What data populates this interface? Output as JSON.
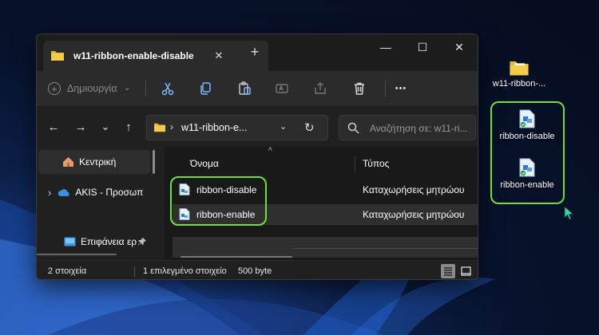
{
  "window": {
    "tab_title": "w11-ribbon-enable-disable",
    "tab_close_glyph": "✕",
    "new_tab_glyph": "+",
    "controls": {
      "minimize": "—",
      "maximize": "☐",
      "close": "✕"
    }
  },
  "commandbar": {
    "new_label": "Δημιουργία",
    "new_dropdown": "⌄",
    "more_glyph": "•••",
    "icons": [
      "cut-icon",
      "copy-icon",
      "paste-icon",
      "rename-icon",
      "share-icon",
      "delete-icon"
    ]
  },
  "navigation": {
    "back": "←",
    "forward": "→",
    "recent": "⌄",
    "up": "↑",
    "address_chevron": "›",
    "address_text": "w11-ribbon-e...",
    "address_dropdown": "⌄",
    "refresh": "↻",
    "search_placeholder": "Αναζήτηση σε: w11-ri..."
  },
  "navpane": {
    "items": [
      {
        "label": "Κεντρική",
        "icon": "home-icon",
        "selected": true
      },
      {
        "label": "AKIS - Προσωπ",
        "icon": "onedrive-icon",
        "expand": "›"
      },
      {
        "label": "Επιφάνεια ερ",
        "icon": "desktop-icon",
        "pin": "📌"
      }
    ]
  },
  "files": {
    "columns": {
      "name": "Όνομα",
      "type": "Τύπος"
    },
    "sort_caret": "^",
    "rows": [
      {
        "name": "ribbon-disable",
        "type": "Καταχωρήσεις μητρώου",
        "selected": false
      },
      {
        "name": "ribbon-enable",
        "type": "Καταχωρήσεις μητρώου",
        "selected": true
      }
    ]
  },
  "status": {
    "items_count": "2 στοιχεία",
    "selected": "1 επιλεγμένο στοιχείο",
    "size": "500 byte"
  },
  "desktop": {
    "folder_label": "w11-ribbon-...",
    "icons": [
      {
        "label": "ribbon-disable"
      },
      {
        "label": "ribbon-enable"
      }
    ]
  },
  "colors": {
    "highlight": "#6ee03a",
    "window_bg": "#202020",
    "folder": "#e8b731"
  }
}
